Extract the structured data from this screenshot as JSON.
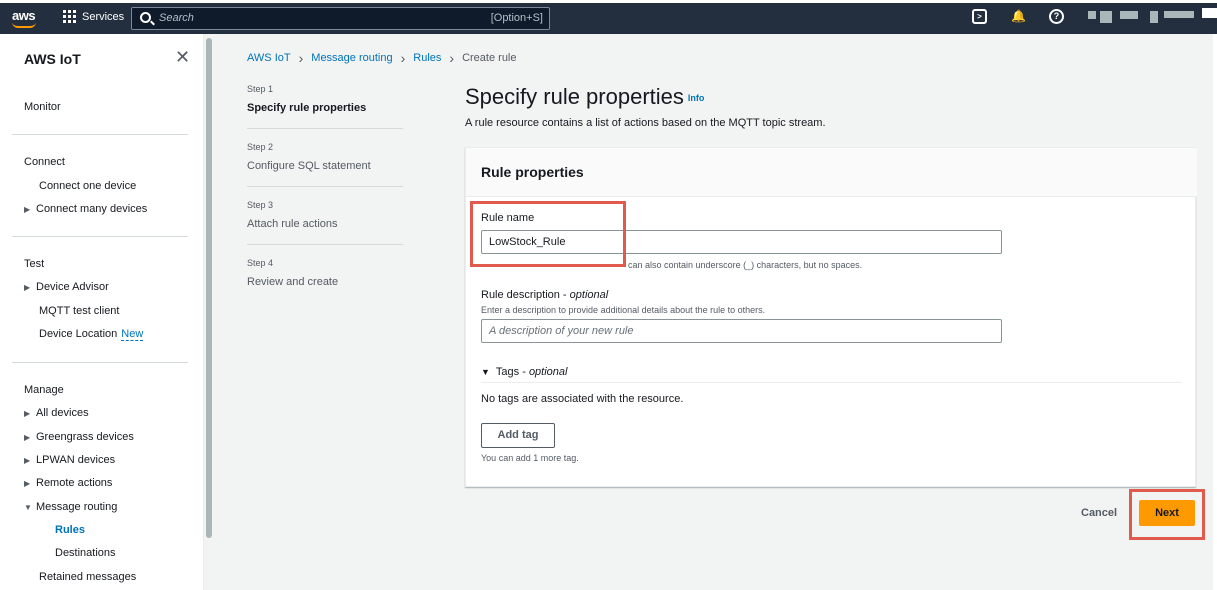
{
  "topbar": {
    "logo": "aws",
    "services_label": "Services",
    "search_placeholder": "Search",
    "search_shortcut": "[Option+S]",
    "icons": [
      "cloudshell-icon",
      "notifications-icon",
      "help-icon"
    ]
  },
  "sidebar": {
    "title": "AWS IoT",
    "monitor": "Monitor",
    "connect": {
      "heading": "Connect",
      "items": [
        "Connect one device",
        "Connect many devices"
      ]
    },
    "test": {
      "heading": "Test",
      "items": [
        "Device Advisor",
        "MQTT test client",
        "Device Location"
      ],
      "new_badge": "New"
    },
    "manage": {
      "heading": "Manage",
      "items": [
        "All devices",
        "Greengrass devices",
        "LPWAN devices",
        "Remote actions",
        "Message routing"
      ],
      "message_routing_children": [
        "Rules",
        "Destinations"
      ],
      "last": "Retained messages"
    }
  },
  "breadcrumb": [
    "AWS IoT",
    "Message routing",
    "Rules",
    "Create rule"
  ],
  "steps": [
    {
      "num": "Step 1",
      "label": "Specify rule properties"
    },
    {
      "num": "Step 2",
      "label": "Configure SQL statement"
    },
    {
      "num": "Step 3",
      "label": "Attach rule actions"
    },
    {
      "num": "Step 4",
      "label": "Review and create"
    }
  ],
  "main": {
    "title": "Specify rule properties",
    "info": "Info",
    "description": "A rule resource contains a list of actions based on the MQTT topic stream."
  },
  "panel": {
    "title": "Rule properties",
    "rule_name_label": "Rule name",
    "rule_name_value": "LowStock_Rule",
    "rule_name_hint": "can also contain underscore (_) characters, but no spaces.",
    "desc_label": "Rule description - ",
    "desc_optional": "optional",
    "desc_hint": "Enter a description to provide additional details about the rule to others.",
    "desc_placeholder": "A description of your new rule",
    "tags_label": "Tags - ",
    "tags_optional": "optional",
    "no_tags": "No tags are associated with the resource.",
    "add_tag": "Add tag",
    "tag_limit": "You can add 1 more tag."
  },
  "footer": {
    "cancel": "Cancel",
    "next": "Next"
  },
  "colors": {
    "nav_bg": "#232f3e",
    "link": "#0073bb",
    "primary_button": "#ff9900",
    "highlight": "#e05a4e"
  }
}
